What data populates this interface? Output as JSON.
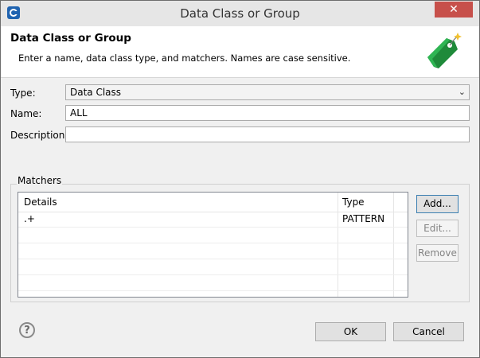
{
  "window": {
    "title": "Data Class or Group",
    "close_glyph": "✕"
  },
  "header": {
    "title": "Data Class or Group",
    "description": "Enter a name, data class type, and matchers. Names are case sensitive.",
    "icon": "green-tag-icon"
  },
  "form": {
    "type_label": "Type:",
    "type_value": "Data Class",
    "name_label": "Name:",
    "name_value": "ALL",
    "description_label": "Description:",
    "description_value": ""
  },
  "matchers": {
    "label": "Matchers",
    "columns": [
      "Details",
      "Type"
    ],
    "rows": [
      {
        "details": ".+",
        "type": "PATTERN"
      }
    ],
    "buttons": {
      "add": "Add...",
      "edit": "Edit...",
      "remove": "Remove"
    }
  },
  "footer": {
    "help_glyph": "?",
    "ok": "OK",
    "cancel": "Cancel"
  }
}
